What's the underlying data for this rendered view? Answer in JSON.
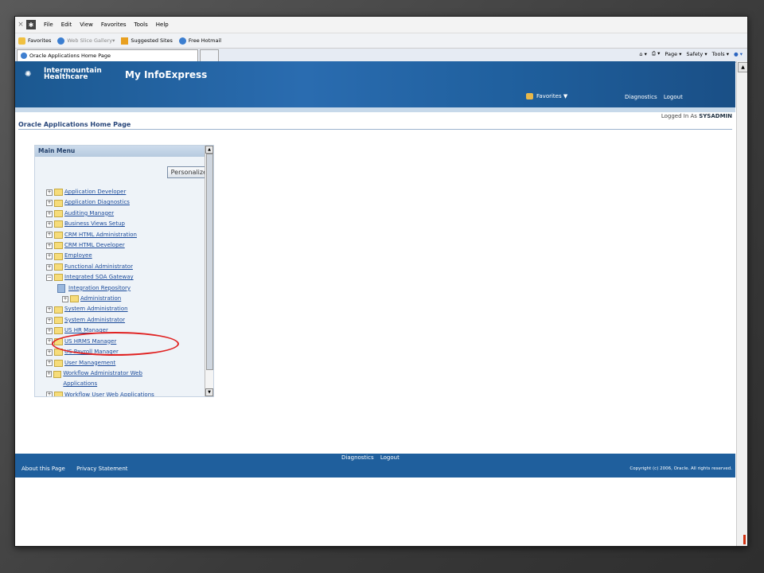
{
  "browser": {
    "menu": [
      "File",
      "Edit",
      "View",
      "Favorites",
      "Tools",
      "Help"
    ],
    "favorites_label": "Favorites",
    "fav_links": [
      "Web Slice Gallery",
      "Suggested Sites",
      "Free Hotmail"
    ],
    "tab_title": "Oracle Applications Home Page",
    "commands": [
      "Page",
      "Safety",
      "Tools"
    ]
  },
  "banner": {
    "brand_line1": "Intermountain",
    "brand_line2": "Healthcare",
    "app_name": "My InfoExpress",
    "favorites": "Favorites",
    "diagnostics": "Diagnostics",
    "logout": "Logout"
  },
  "session": {
    "logged_in_prefix": "Logged In As",
    "user": "SYSADMIN"
  },
  "page_title": "Oracle Applications Home Page",
  "main_menu": {
    "title": "Main Menu",
    "personalize": "Personalize",
    "items": [
      "Application Developer",
      "Application Diagnostics",
      "Auditing Manager",
      "Business Views Setup",
      "CRM HTML Administration",
      "CRM HTML Developer",
      "Employee",
      "Functional Administrator",
      "Integrated SOA Gateway",
      "System Administration",
      "System Administrator",
      "US HR Manager",
      "US HRMS Manager",
      "US Payroll Manager",
      "User Management",
      "Workflow Administrator Web Applications",
      "Workflow User Web Applications"
    ],
    "soa_children": {
      "repository": "Integration Repository",
      "administration": "Administration"
    }
  },
  "footer": {
    "diagnostics": "Diagnostics",
    "logout": "Logout",
    "about": "About this Page",
    "privacy": "Privacy Statement",
    "copyright": "Copyright (c) 2006, Oracle. All rights reserved."
  }
}
